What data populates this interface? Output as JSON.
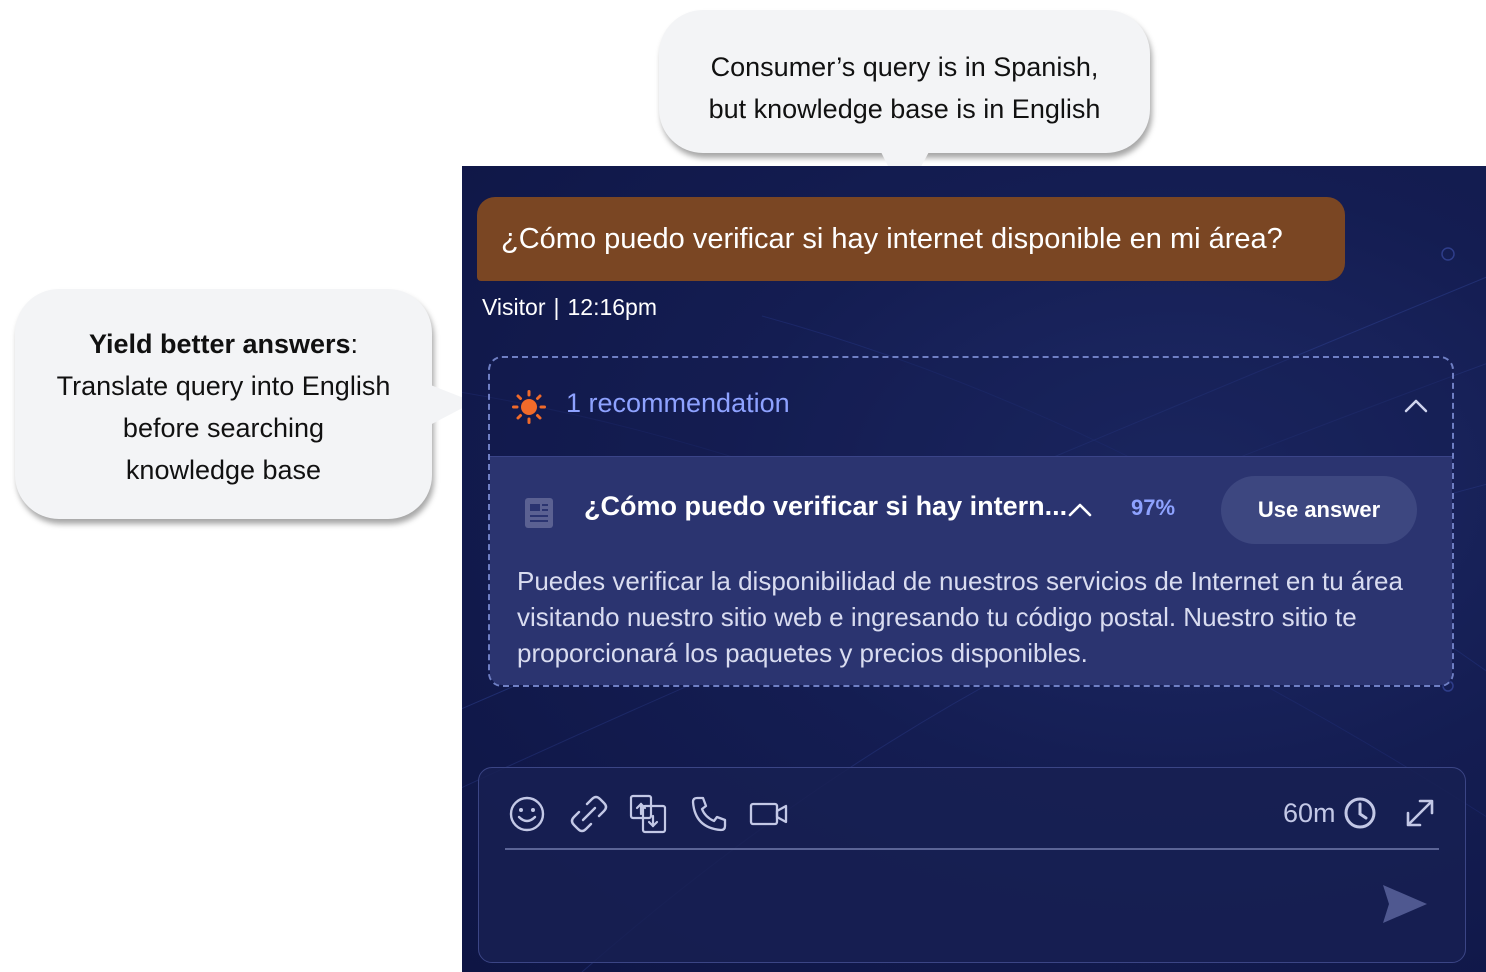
{
  "callouts": {
    "top": {
      "line1": "Consumer’s query is in Spanish,",
      "line2": "but knowledge base is in English"
    },
    "left": {
      "bold": "Yield better answers",
      "colon": ":",
      "line2": "Translate query into English",
      "line3": "before searching",
      "line4": "knowledge base"
    }
  },
  "chat": {
    "visitor_message": "¿Cómo puedo verificar si hay internet disponible en mi área?",
    "sender": "Visitor",
    "separator": "|",
    "time": "12:16pm"
  },
  "recommendations": {
    "count_label": "1 recommendation",
    "answer_title": "¿Cómo puedo verificar si hay intern...",
    "confidence": "97%",
    "use_answer_label": "Use answer",
    "answer_text": "Puedes verificar la disponibilidad de nuestros servicios de Internet en tu área visitando nuestro sitio web e ingresando tu código postal. Nuestro sitio te proporcionará los paquetes y precios disponibles."
  },
  "composer": {
    "timer": "60m",
    "icons": [
      "emoji-icon",
      "attach-link-icon",
      "cobrowse-icon",
      "phone-icon",
      "video-icon",
      "clock-icon",
      "fullscreen-icon",
      "send-icon"
    ]
  },
  "colors": {
    "panel_bg": "#141d52",
    "visitor_bubble": "#7a4623",
    "accent_blue": "#8ea2ff",
    "sun_orange": "#f06a2a",
    "callout_bg": "#f3f4f6"
  }
}
